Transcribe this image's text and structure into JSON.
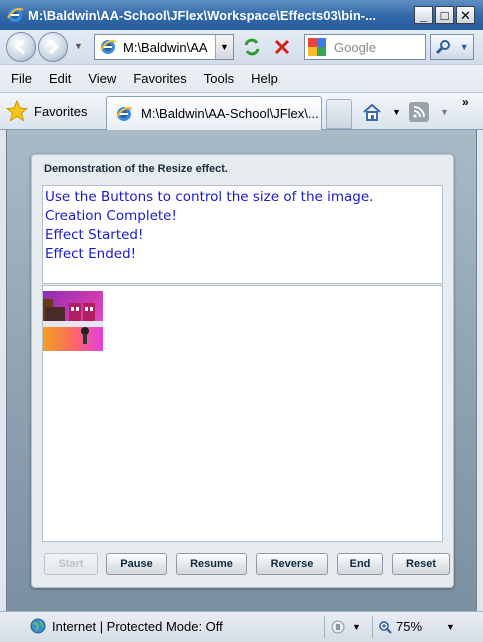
{
  "window": {
    "title": "M:\\Baldwin\\AA-School\\JFlex\\Workspace\\Effects03\\bin-...",
    "min": "_",
    "max": "□",
    "close": "✕"
  },
  "address": {
    "value": "M:\\Baldwin\\AA"
  },
  "search": {
    "placeholder": "Google"
  },
  "menu": [
    "File",
    "Edit",
    "View",
    "Favorites",
    "Tools",
    "Help"
  ],
  "favorites": {
    "label": "Favorites"
  },
  "tab": {
    "label": "M:\\Baldwin\\AA-School\\JFlex\\..."
  },
  "app": {
    "panel_title": "Demonstration of the Resize effect.",
    "log_lines": [
      "Use the Buttons to control the size of the image.",
      "Creation Complete!",
      "Effect Started!",
      "Effect Ended!"
    ],
    "buttons": {
      "start": "Start",
      "pause": "Pause",
      "resume": "Resume",
      "reverse": "Reverse",
      "end": "End",
      "reset": "Reset"
    }
  },
  "status": {
    "zone": "Internet | Protected Mode: Off",
    "zoom": "75%"
  }
}
